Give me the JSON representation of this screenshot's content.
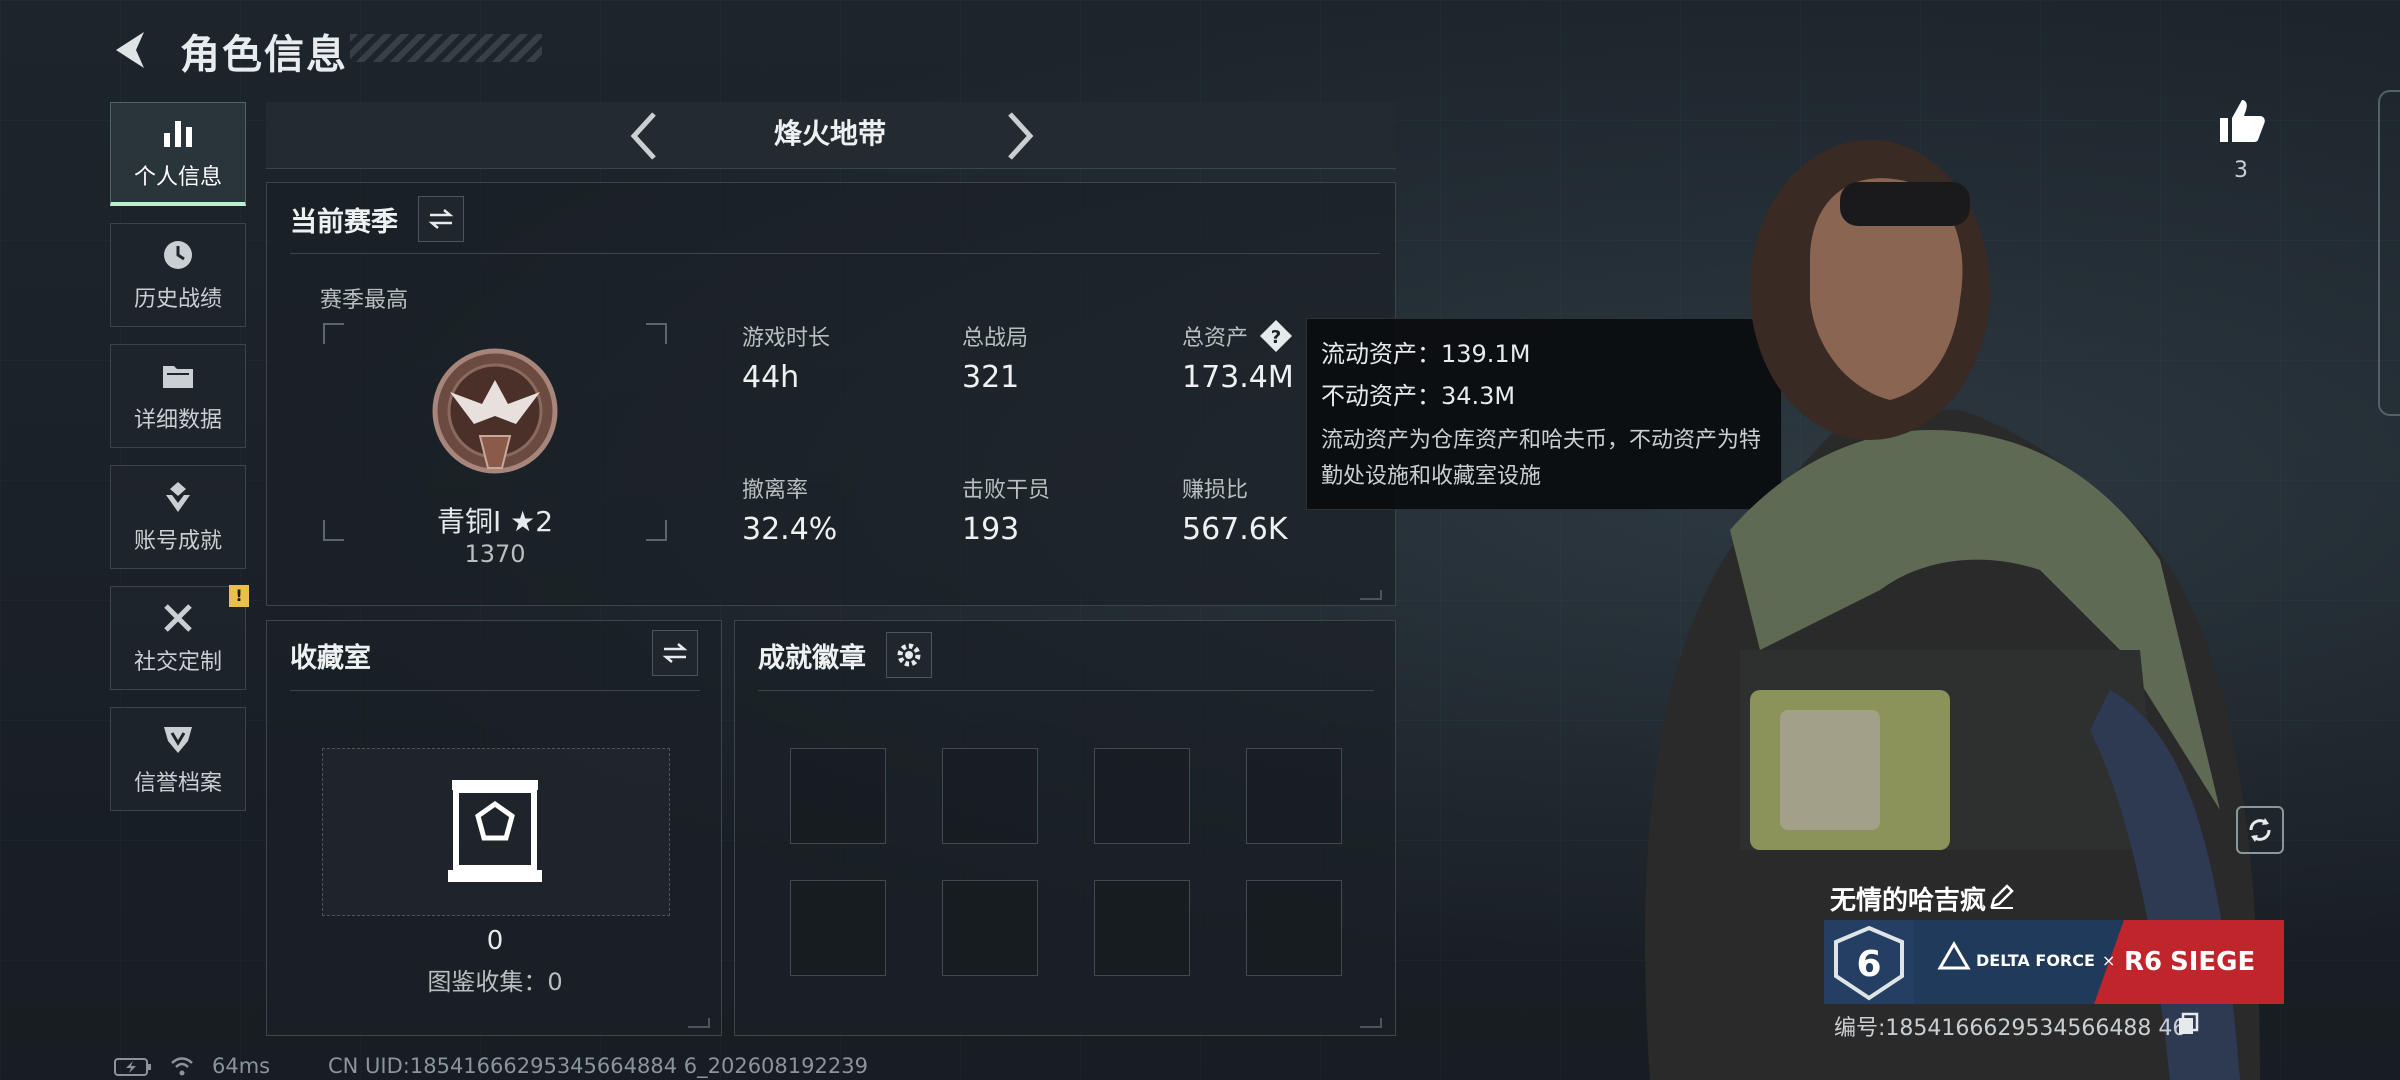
{
  "header": {
    "title": "角色信息"
  },
  "nav": {
    "items": [
      {
        "label": "个人信息",
        "icon": "bar-chart-icon",
        "active": true
      },
      {
        "label": "历史战绩",
        "icon": "clock-icon"
      },
      {
        "label": "详细数据",
        "icon": "folder-icon"
      },
      {
        "label": "账号成就",
        "icon": "trophy-icon"
      },
      {
        "label": "社交定制",
        "icon": "tools-icon",
        "badge": "!"
      },
      {
        "label": "信誉档案",
        "icon": "shield-icon"
      }
    ]
  },
  "mode": {
    "label": "烽火地带"
  },
  "season": {
    "title": "当前赛季",
    "best_label": "赛季最高",
    "rank_name": "青铜I ★2",
    "rank_points": "1370",
    "stats": [
      {
        "label": "游戏时长",
        "value": "44h"
      },
      {
        "label": "总战局",
        "value": "321"
      },
      {
        "label": "总资产",
        "value": "173.4M"
      },
      {
        "label": "撤离率",
        "value": "32.4%"
      },
      {
        "label": "击败干员",
        "value": "193"
      },
      {
        "label": "赚损比",
        "value": "567.6K"
      }
    ]
  },
  "tooltip": {
    "liquid": "流动资产：139.1M",
    "fixed": "不动资产：34.3M",
    "desc": "流动资产为仓库资产和哈夫币，不动资产为特勤处设施和收藏室设施"
  },
  "collection": {
    "title": "收藏室",
    "count": "0",
    "index_label": "图鉴收集：0"
  },
  "achievements": {
    "title": "成就徽章"
  },
  "social": {
    "likes": "3"
  },
  "player": {
    "name": "无情的哈吉疯",
    "id_label": "编号:1854166629534566488 46",
    "banner_left": "6",
    "banner_brand": "DELTA FORCE",
    "banner_x": "×",
    "banner_r6": "R6",
    "banner_siege": "SIEGE"
  },
  "status": {
    "ping": "64ms",
    "uid": "CN UID:18541666295345664884 6_202608192239"
  },
  "colors": {
    "accent": "#b9f0d0",
    "badge": "#e8c04a",
    "banner_red": "#c0252b"
  }
}
